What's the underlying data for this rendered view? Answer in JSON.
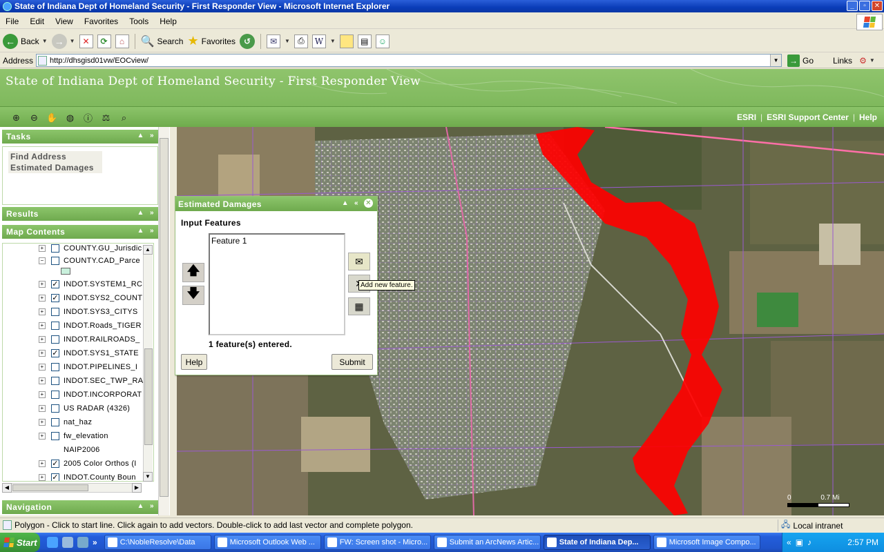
{
  "window": {
    "title": "State of Indiana Dept of Homeland Security - First Responder View - Microsoft Internet Explorer",
    "min": "_",
    "max": "▫",
    "close": "✕"
  },
  "menu": [
    "File",
    "Edit",
    "View",
    "Favorites",
    "Tools",
    "Help"
  ],
  "toolbar": {
    "back": "Back",
    "search": "Search",
    "favorites": "Favorites"
  },
  "address": {
    "label": "Address",
    "url": "http://dhsgisd01vw/EOCview/",
    "go": "Go",
    "links": "Links"
  },
  "app": {
    "title": "State of Indiana Dept of Homeland Security - First Responder View",
    "links": [
      "ESRI",
      "ESRI Support Center",
      "Help"
    ]
  },
  "panels": {
    "tasks": {
      "title": "Tasks",
      "items": [
        "Find Address",
        "Estimated Damages"
      ]
    },
    "results": {
      "title": "Results"
    },
    "map_contents": {
      "title": "Map Contents",
      "layers": [
        {
          "name": "COUNTY.GU_Jurisdic",
          "checked": false,
          "expander": "+"
        },
        {
          "name": "COUNTY.CAD_Parce",
          "checked": false,
          "expander": "−"
        },
        {
          "name": "INDOT.SYSTEM1_RC",
          "checked": true,
          "expander": "+"
        },
        {
          "name": "INDOT.SYS2_COUNT",
          "checked": true,
          "expander": "+"
        },
        {
          "name": "INDOT.SYS3_CITYS",
          "checked": false,
          "expander": "+"
        },
        {
          "name": "INDOT.Roads_TIGER",
          "checked": false,
          "expander": "+"
        },
        {
          "name": "INDOT.RAILROADS_",
          "checked": false,
          "expander": "+"
        },
        {
          "name": "INDOT.SYS1_STATE",
          "checked": true,
          "expander": "+"
        },
        {
          "name": "INDOT.PIPELINES_I",
          "checked": false,
          "expander": "+"
        },
        {
          "name": "INDOT.SEC_TWP_RA",
          "checked": false,
          "expander": "+"
        },
        {
          "name": "INDOT.INCORPORAT",
          "checked": false,
          "expander": "+"
        },
        {
          "name": "US RADAR (4326)",
          "checked": false,
          "expander": "+"
        },
        {
          "name": "nat_haz",
          "checked": false,
          "expander": "+"
        },
        {
          "name": "fw_elevation",
          "checked": false,
          "expander": "+"
        },
        {
          "name": "NAIP2006",
          "checked": null,
          "expander": ""
        },
        {
          "name": "2005 Color Orthos (I",
          "checked": true,
          "expander": "+"
        },
        {
          "name": "INDOT.County Boun",
          "checked": true,
          "expander": "+"
        }
      ]
    },
    "navigation": {
      "title": "Navigation"
    }
  },
  "estimated_damages": {
    "title": "Estimated Damages",
    "input_label": "Input Features",
    "features": [
      "Feature 1"
    ],
    "tooltip": "Add new feature.",
    "count_text": "1 feature(s) entered.",
    "help": "Help",
    "submit": "Submit"
  },
  "map": {
    "scale_zero": "0",
    "scale_unit": "0.7 Mi",
    "flood_color": "#ff0000"
  },
  "status": {
    "message": "Polygon - Click to start line. Click again to add vectors. Double-click to add last vector and complete polygon.",
    "zone": "Local intranet"
  },
  "taskbar": {
    "start": "Start",
    "tasks": [
      {
        "label": "C:\\NobleResolve\\Data",
        "active": false
      },
      {
        "label": "Microsoft Outlook Web ...",
        "active": false
      },
      {
        "label": "FW: Screen shot - Micro...",
        "active": false
      },
      {
        "label": "Submit an ArcNews Artic...",
        "active": false
      },
      {
        "label": "State of Indiana Dep...",
        "active": true
      },
      {
        "label": "Microsoft Image Compo...",
        "active": false
      }
    ],
    "clock": "2:57 PM"
  }
}
